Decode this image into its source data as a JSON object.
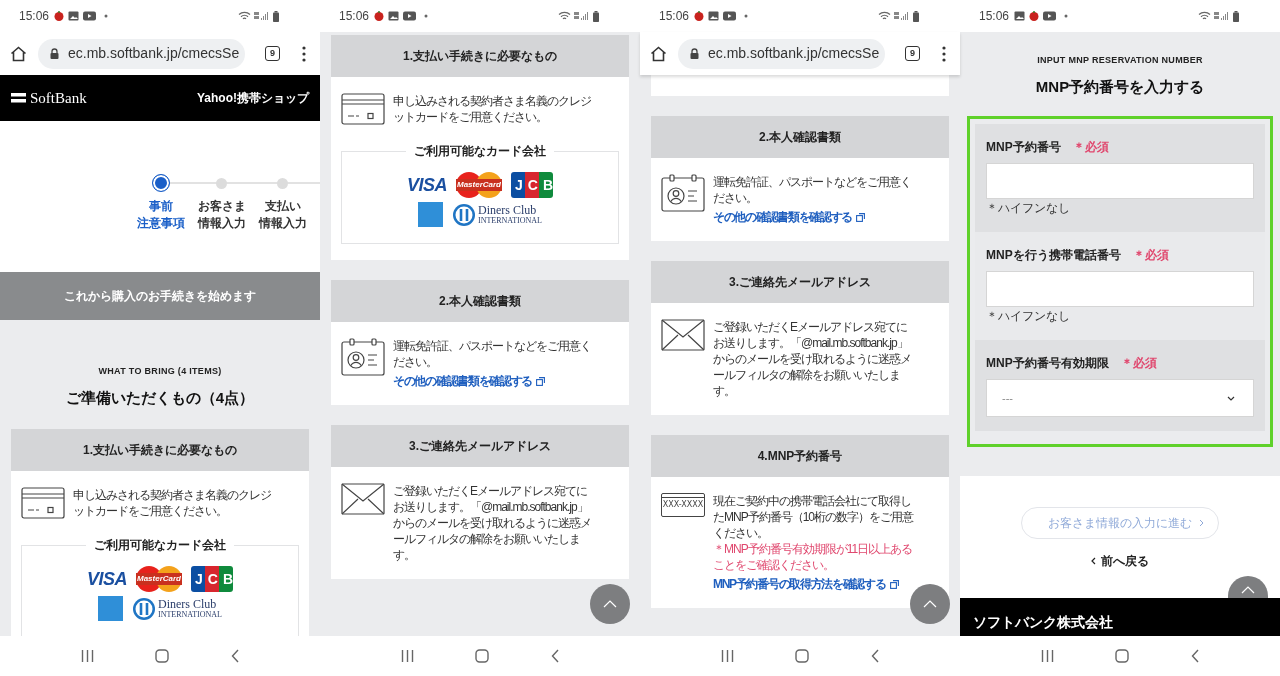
{
  "screens": [
    {
      "status_bar": {
        "time": "15:06"
      },
      "browser_bar": {
        "url": "ec.mb.softbank.jp/cmecsSe",
        "tab_count": "9"
      },
      "scroll_top_button": false,
      "blocks": [
        {
          "kind": "site_header",
          "logo": "SoftBank",
          "shop": "Yahoo!携帯ショップ"
        },
        {
          "kind": "stepper",
          "steps": [
            {
              "lines": [
                "事前",
                "注意事項"
              ],
              "selected": true
            },
            {
              "lines": [
                "お客さま",
                "情報入力"
              ],
              "selected": false
            },
            {
              "lines": [
                "支払い",
                "情報入力"
              ],
              "selected": false
            }
          ]
        },
        {
          "kind": "banner",
          "text": "これから購入のお手続きを始めます"
        },
        {
          "kind": "section_heading",
          "eyebrow": "WHAT TO BRING (4 ITEMS)",
          "title": "ご準備いただくもの（4点）"
        },
        {
          "kind": "payment_card",
          "title": "1.支払い手続きに必要なもの",
          "text": "申し込みされる契約者さま名義のクレジットカードをご用意ください。",
          "brands": {
            "title": "ご利用可能なカード会社",
            "logos": [
              {
                "kind": "visa",
                "name": "VISA"
              },
              {
                "kind": "mastercard",
                "name": "MasterCard"
              },
              {
                "kind": "jcb",
                "name": "JCB"
              },
              {
                "kind": "amex"
              },
              {
                "kind": "diners",
                "name": "Diners Club",
                "sub": "INTERNATIONAL"
              }
            ]
          }
        }
      ]
    },
    {
      "status_bar": {
        "time": "15:06"
      },
      "scroll_top_button": true,
      "blocks": [
        {
          "kind": "payment_card",
          "title": "1.支払い手続きに必要なもの",
          "text": "申し込みされる契約者さま名義のクレジットカードをご用意ください。",
          "brands": {
            "title": "ご利用可能なカード会社",
            "logos": [
              {
                "kind": "visa",
                "name": "VISA"
              },
              {
                "kind": "mastercard",
                "name": "MasterCard"
              },
              {
                "kind": "jcb",
                "name": "JCB"
              },
              {
                "kind": "amex"
              },
              {
                "kind": "diners",
                "name": "Diners Club",
                "sub": "INTERNATIONAL"
              }
            ]
          }
        },
        {
          "kind": "id_card",
          "title": "2.本人確認書類",
          "text": "運転免許証、パスポートなどをご用意ください。",
          "link": "その他の確認書類を確認する"
        },
        {
          "kind": "email_card",
          "title": "3.ご連絡先メールアドレス",
          "text": "ご登録いただくEメールアドレス宛てにお送りします。「@mail.mb.softbank.jp」からのメールを受け取れるように迷惑メールフィルタの解除をお願いいたします。"
        }
      ]
    },
    {
      "status_bar": {
        "time": "15:06"
      },
      "browser_bar": {
        "url": "ec.mb.softbank.jp/cmecsSe",
        "tab_count": "9"
      },
      "scroll_top_button": true,
      "blocks": [
        {
          "kind": "card_end"
        },
        {
          "kind": "id_card",
          "title": "2.本人確認書類",
          "text": "運転免許証、パスポートなどをご用意ください。",
          "link": "その他の確認書類を確認する"
        },
        {
          "kind": "email_card",
          "title": "3.ご連絡先メールアドレス",
          "text": "ご登録いただくEメールアドレス宛てにお送りします。「@mail.mb.softbank.jp」からのメールを受け取れるように迷惑メールフィルタの解除をお願いいたします。"
        },
        {
          "kind": "mnp_card",
          "title": "4.MNP予約番号",
          "icon_text": "XXX-XXXX",
          "text": "現在ご契約中の携帯電話会社にて取得したMNP予約番号（10桁の数字）をご用意ください。",
          "note": "＊MNP予約番号有効期限が11日以上あることをご確認ください。",
          "link": "MNP予約番号の取得方法を確認する"
        }
      ]
    },
    {
      "status_bar": {
        "time": "15:06"
      },
      "scroll_top_button": true,
      "blocks": [
        {
          "kind": "section_heading",
          "eyebrow": "INPUT MNP RESERVATION NUMBER",
          "title": "MNP予約番号を入力する"
        },
        {
          "kind": "form",
          "highlighted": true,
          "fields": [
            {
              "kind": "text",
              "label": "MNP予約番号",
              "required": "＊必須",
              "hint": "＊ハイフンなし"
            },
            {
              "kind": "text",
              "label": "MNPを行う携帯電話番号",
              "required": "＊必須",
              "hint": "＊ハイフンなし"
            },
            {
              "kind": "select",
              "label": "MNP予約番号有効期限",
              "required": "＊必須",
              "value": "---"
            }
          ]
        },
        {
          "kind": "actions",
          "next_button": {
            "label": "お客さま情報の入力に進む",
            "disabled": true
          },
          "back_link": "前へ戻る"
        },
        {
          "kind": "footer",
          "company": "ソフトバンク株式会社"
        }
      ]
    }
  ]
}
